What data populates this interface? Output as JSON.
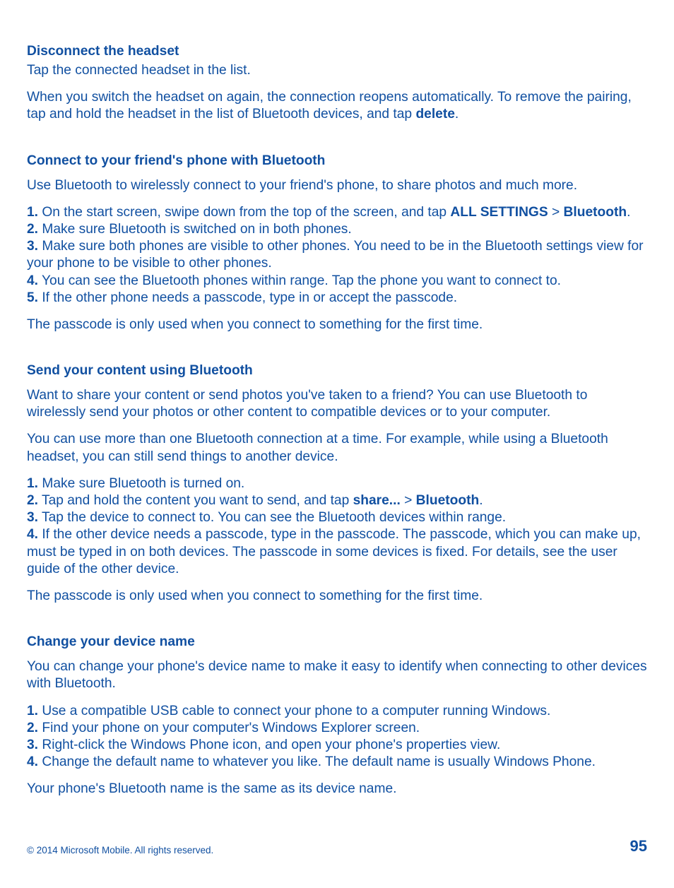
{
  "sections": {
    "disconnect": {
      "heading": "Disconnect the headset",
      "p1": "Tap the connected headset in the list.",
      "p2_a": "When you switch the headset on again, the connection reopens automatically. To remove the pairing, tap and hold the headset in the list of Bluetooth devices, and tap ",
      "p2_b_bold": "delete",
      "p2_c": "."
    },
    "connect": {
      "heading": "Connect to your friend's phone with Bluetooth",
      "p1": "Use Bluetooth to wirelessly connect to your friend's phone, to share photos and much more.",
      "steps": {
        "n1": "1.",
        "t1_a": " On the start screen, swipe down from the top of the screen, and tap ",
        "t1_b_bold": "ALL SETTINGS",
        "t1_c": " > ",
        "t1_d_bold": "Bluetooth",
        "t1_e": ".",
        "n2": "2.",
        "t2": " Make sure Bluetooth is switched on in both phones.",
        "n3": "3.",
        "t3": " Make sure both phones are visible to other phones. You need to be in the Bluetooth settings view for your phone to be visible to other phones.",
        "n4": "4.",
        "t4": " You can see the Bluetooth phones within range. Tap the phone you want to connect to.",
        "n5": "5.",
        "t5": " If the other phone needs a passcode, type in or accept the passcode."
      },
      "p2": "The passcode is only used when you connect to something for the first time."
    },
    "send": {
      "heading": "Send your content using Bluetooth",
      "p1": "Want to share your content or send photos you've taken to a friend? You can use Bluetooth to wirelessly send your photos or other content to compatible devices or to your computer.",
      "p2": "You can use more than one Bluetooth connection at a time. For example, while using a Bluetooth headset, you can still send things to another device.",
      "steps": {
        "n1": "1.",
        "t1": " Make sure Bluetooth is turned on.",
        "n2": "2.",
        "t2_a": " Tap and hold the content you want to send, and tap ",
        "t2_b_bold": "share...",
        "t2_c": " > ",
        "t2_d_bold": "Bluetooth",
        "t2_e": ".",
        "n3": "3.",
        "t3": " Tap the device to connect to. You can see the Bluetooth devices within range.",
        "n4": "4.",
        "t4": " If the other device needs a passcode, type in the passcode. The passcode, which you can make up, must be typed in on both devices. The passcode in some devices is fixed. For details, see the user guide of the other device."
      },
      "p3": "The passcode is only used when you connect to something for the first time."
    },
    "change": {
      "heading": "Change your device name",
      "p1": "You can change your phone's device name to make it easy to identify when connecting to other devices with Bluetooth.",
      "steps": {
        "n1": "1.",
        "t1": " Use a compatible USB cable to connect your phone to a computer running Windows.",
        "n2": "2.",
        "t2": " Find your phone on your computer's Windows Explorer screen.",
        "n3": "3.",
        "t3": " Right-click the Windows Phone icon, and open your phone's properties view.",
        "n4": "4.",
        "t4": " Change the default name to whatever you like. The default name is usually Windows Phone."
      },
      "p2": "Your phone's Bluetooth name is the same as its device name."
    }
  },
  "footer": {
    "copyright": "© 2014 Microsoft Mobile. All rights reserved.",
    "page": "95"
  }
}
